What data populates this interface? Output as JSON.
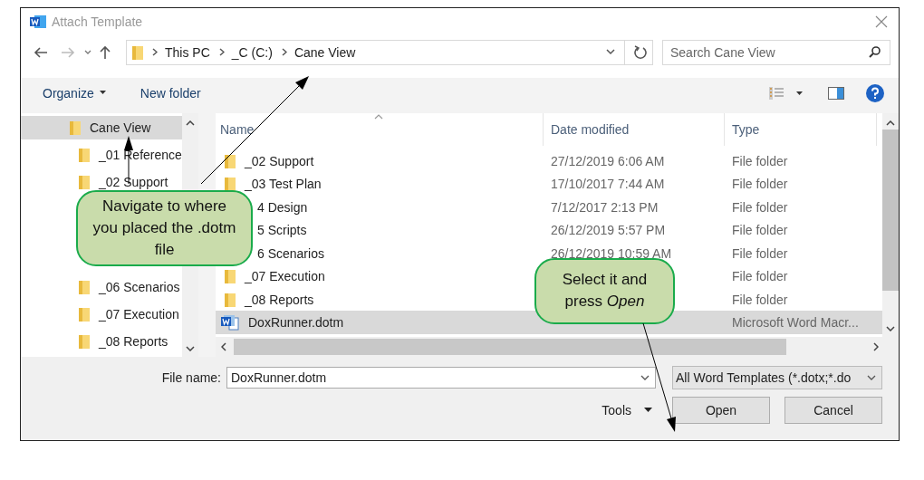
{
  "window": {
    "title": "Attach Template"
  },
  "address_bar": {
    "path": [
      "This PC",
      "_C (C:)",
      "Cane View"
    ]
  },
  "search": {
    "placeholder": "Search Cane View"
  },
  "toolbar": {
    "organize": "Organize",
    "new_folder": "New folder"
  },
  "tree": {
    "label": "Cane View",
    "selected": true,
    "children": [
      {
        "label": "_01 Reference",
        "selected": false
      },
      {
        "label": "_02 Support",
        "selected": false
      },
      {
        "label": "_06 Scenarios",
        "selected": false
      },
      {
        "label": "_07 Execution",
        "selected": false
      },
      {
        "label": "_08 Reports",
        "selected": false
      }
    ]
  },
  "table": {
    "columns": [
      "Name",
      "Date modified",
      "Type"
    ],
    "rows": [
      {
        "kind": "folder",
        "name": "_02 Support",
        "date": "27/12/2019 6:06 AM",
        "type": "File folder",
        "selected": false
      },
      {
        "kind": "folder",
        "name": "_03 Test Plan",
        "date": "17/10/2017 7:44 AM",
        "type": "File folder",
        "selected": false
      },
      {
        "name": "4 Design",
        "date": "7/12/2017 2:13 PM",
        "type": "File folder",
        "selected": false
      },
      {
        "name": "5 Scripts",
        "date": "26/12/2019 5:57 PM",
        "type": "File folder",
        "selected": false
      },
      {
        "name": "6 Scenarios",
        "date": "26/12/2019 10:59 AM",
        "type": "File folder",
        "selected": false
      },
      {
        "kind": "folder",
        "name": "_07 Execution",
        "type": "File folder",
        "selected": false
      },
      {
        "kind": "folder",
        "name": "_08 Reports",
        "type": "File folder",
        "selected": false
      },
      {
        "kind": "word",
        "name": "DoxRunner.dotm",
        "type": "Microsoft Word Macr...",
        "selected": true
      }
    ]
  },
  "footer": {
    "file_name_label": "File name:",
    "file_name": "DoxRunner.dotm",
    "filter": "All Word Templates (*.dotx;*.do",
    "tools": "Tools",
    "buttons": [
      "Open",
      "Cancel"
    ]
  },
  "callouts": [
    {
      "text": "Navigate to where you placed the .dotm file"
    },
    {
      "text": "Select it and press *Open*"
    }
  ]
}
